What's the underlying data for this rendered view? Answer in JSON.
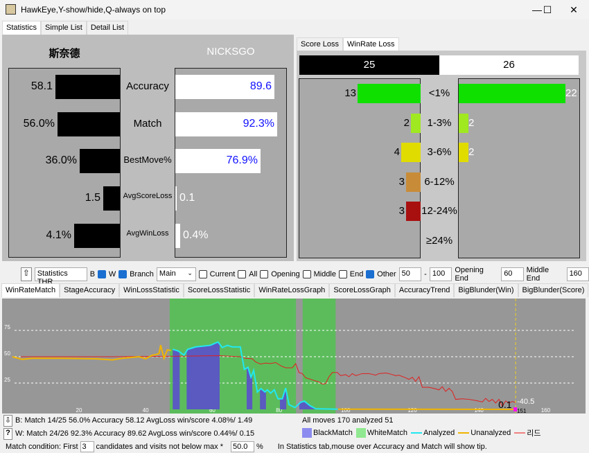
{
  "window": {
    "title": "HawkEye,Y-show/hide,Q-always on top"
  },
  "main_tabs": [
    "Statistics",
    "Simple List",
    "Detail List"
  ],
  "stats": {
    "black_name": "斯奈德",
    "white_name": "NICKSGO",
    "rows": [
      {
        "label": "Accuracy",
        "black": "58.1",
        "white": "89.6",
        "black_value": 58.1,
        "white_value": 89.6
      },
      {
        "label": "Match",
        "black": "56.0%",
        "white": "92.3%",
        "black_value": 56.0,
        "white_value": 92.3
      },
      {
        "label": "BestMove%",
        "black": "36.0%",
        "white": "76.9%",
        "black_value": 36.0,
        "white_value": 76.9
      },
      {
        "label": "AvgScoreLoss",
        "black": "1.5",
        "white": "0.1",
        "black_value": 1.5,
        "white_value": 0.1
      },
      {
        "label": "AvgWinLoss",
        "black": "4.1%",
        "white": "0.4%",
        "black_value": 4.1,
        "white_value": 0.4
      }
    ]
  },
  "loss_tabs": [
    "Score Loss",
    "WinRate Loss"
  ],
  "loss": {
    "black_total": "25",
    "white_total": "26",
    "rows": [
      {
        "label": "<1%",
        "black": "13",
        "white": "22",
        "color": "#10e000"
      },
      {
        "label": "1-3%",
        "black": "2",
        "white": "2",
        "color": "#a0e820"
      },
      {
        "label": "3-6%",
        "black": "4",
        "white": "2",
        "color": "#e0dc00"
      },
      {
        "label": "6-12%",
        "black": "3",
        "white": "",
        "color": "#c88c38"
      },
      {
        "label": "12-24%",
        "black": "3",
        "white": "",
        "color": "#a81010"
      },
      {
        "label": "≥24%",
        "black": "",
        "white": "",
        "color": "#888888"
      }
    ]
  },
  "toolbar": {
    "stats_thr": "Statistics THR",
    "b": "B",
    "w": "W",
    "w_checked": true,
    "branch": "Branch",
    "branch_checked": true,
    "branch_select": "Main",
    "current": "Current",
    "all": "All",
    "opening": "Opening",
    "middle": "Middle",
    "end": "End",
    "other": "Other",
    "other_checked": true,
    "range_from": "50",
    "dash": "-",
    "range_to": "100",
    "opening_end": "Opening End",
    "opening_end_val": "60",
    "middle_end": "Middle End",
    "middle_end_val": "160"
  },
  "chart_tabs": [
    "WinRateMatch",
    "StageAccuracy",
    "WinLossStatistic",
    "ScoreLossStatistic",
    "WinRateLossGraph",
    "ScoreLossGraph",
    "AccuracyTrend",
    "BigBlunder(Win)",
    "BigBlunder(Score)"
  ],
  "chart_data": {
    "type": "line",
    "xticks": [
      20,
      40,
      60,
      80,
      100,
      120,
      140,
      160
    ],
    "yticks": [
      25,
      50,
      75
    ],
    "xlim": [
      0,
      170
    ],
    "ylim": [
      0,
      100
    ],
    "grid": true,
    "white_match_ranges": [
      [
        47.2,
        85.1
      ],
      [
        87.1,
        97
      ]
    ],
    "black_match_ranges": [
      [
        48.1,
        50.2
      ],
      [
        52.3,
        62.2
      ],
      [
        70.3,
        72
      ],
      [
        74.3,
        76.1
      ],
      [
        80.3,
        82.2
      ],
      [
        86.1,
        94.1
      ],
      [
        96,
        98.3
      ]
    ],
    "series": [
      {
        "name": "Unanalyzed",
        "color": "#f0b400",
        "points": [
          [
            0,
            50
          ],
          [
            3,
            47.5
          ],
          [
            6,
            48.5
          ],
          [
            15,
            48.5
          ],
          [
            25,
            48
          ],
          [
            30,
            47
          ],
          [
            33,
            48.5
          ],
          [
            38,
            50
          ],
          [
            40,
            48
          ],
          [
            42,
            51.5
          ],
          [
            43,
            52
          ],
          [
            44,
            53
          ],
          [
            44.5,
            61
          ],
          [
            45.5,
            48.5
          ],
          [
            46.5,
            56.5
          ],
          [
            47.6,
            56
          ]
        ]
      },
      {
        "name": "Analyzed",
        "color": "#20e8f0",
        "points": [
          [
            48.1,
            57.1
          ],
          [
            49.8,
            55.4
          ],
          [
            51.5,
            51.5
          ],
          [
            52.6,
            57
          ],
          [
            55,
            59.3
          ],
          [
            59.4,
            60.8
          ],
          [
            61.7,
            64
          ],
          [
            63,
            58.7
          ],
          [
            64.5,
            60.8
          ],
          [
            66,
            59.3
          ],
          [
            68.4,
            59.3
          ],
          [
            69.6,
            38
          ],
          [
            70.7,
            40
          ],
          [
            71.6,
            30.5
          ],
          [
            72.4,
            37
          ],
          [
            73.5,
            16.5
          ],
          [
            74.6,
            19.7
          ],
          [
            75.8,
            16.5
          ],
          [
            76.5,
            18.6
          ],
          [
            77.5,
            15.4
          ],
          [
            78.6,
            18.6
          ],
          [
            79.7,
            10
          ],
          [
            81,
            10
          ],
          [
            82,
            20.3
          ],
          [
            83,
            4.5
          ],
          [
            84.8,
            1.7
          ],
          [
            86.5,
            6.7
          ],
          [
            87.6,
            7.8
          ],
          [
            89.3,
            3.5
          ],
          [
            91,
            0.6
          ],
          [
            97.7,
            0.2
          ]
        ]
      },
      {
        "name": "Unanalyzed",
        "color": "#f0b400",
        "points": [
          [
            97.7,
            0.2
          ],
          [
            151,
            0
          ]
        ]
      },
      {
        "name": "리드",
        "color": "#e02020",
        "points": [
          [
            2.5,
            50
          ],
          [
            30,
            50
          ],
          [
            50,
            50.5
          ],
          [
            62,
            51
          ],
          [
            68.4,
            50
          ],
          [
            70,
            48.5
          ],
          [
            72,
            48
          ],
          [
            73,
            45
          ],
          [
            74.5,
            43
          ],
          [
            76,
            44
          ],
          [
            77.5,
            43.5
          ],
          [
            79,
            44.5
          ],
          [
            80.5,
            41.5
          ],
          [
            82,
            39.5
          ],
          [
            84,
            39.5
          ],
          [
            85,
            43.5
          ],
          [
            86,
            35
          ],
          [
            87,
            34
          ],
          [
            88,
            30
          ],
          [
            90,
            28
          ],
          [
            92,
            26
          ],
          [
            93,
            24
          ],
          [
            94,
            24.5
          ],
          [
            95,
            31
          ],
          [
            96,
            35
          ],
          [
            97.5,
            35
          ],
          [
            98.5,
            32
          ],
          [
            100,
            33
          ],
          [
            101,
            31
          ],
          [
            102,
            34
          ],
          [
            103,
            32
          ],
          [
            105,
            34
          ],
          [
            107,
            34
          ],
          [
            109,
            32.5
          ],
          [
            110,
            34
          ],
          [
            112,
            34.5
          ],
          [
            113,
            34
          ],
          [
            115,
            32
          ],
          [
            116,
            32.5
          ],
          [
            118,
            30
          ],
          [
            119,
            28.5
          ],
          [
            120,
            30.5
          ],
          [
            121,
            26.5
          ],
          [
            122,
            31
          ],
          [
            123,
            21
          ],
          [
            125,
            21
          ],
          [
            127,
            19.5
          ],
          [
            128,
            18.5
          ],
          [
            129,
            21.5
          ],
          [
            130,
            17
          ],
          [
            131,
            20
          ],
          [
            132,
            17
          ],
          [
            133,
            9.5
          ],
          [
            135,
            10
          ],
          [
            137,
            9.5
          ],
          [
            139,
            8.5
          ],
          [
            141,
            7
          ],
          [
            142,
            10.5
          ],
          [
            143,
            7.5
          ],
          [
            144,
            9.5
          ],
          [
            145,
            6
          ],
          [
            146,
            9.5
          ],
          [
            147,
            3
          ],
          [
            148,
            8
          ],
          [
            149,
            6
          ],
          [
            150,
            7.5
          ],
          [
            151,
            6.5
          ]
        ]
      }
    ],
    "current_move": 151,
    "current_label": "151",
    "value_label": "0.1",
    "lead_label": "-40.5"
  },
  "footer": {
    "b_line": "B: Match 14/25 56.0% Accuracy 58.12 AvgLoss win/score 4.08%/ 1.49",
    "w_line": "W: Match 24/26 92.3% Accuracy 89.62 AvgLoss win/score 0.44%/ 0.15",
    "all_moves": "All moves 170 analyzed 51",
    "legend": [
      {
        "label": "BlackMatch",
        "color": "#8c8cf0"
      },
      {
        "label": "WhiteMatch",
        "color": "#90e890"
      },
      {
        "label": "Analyzed",
        "color": "#20e8f0"
      },
      {
        "label": "Unanalyzed",
        "color": "#f0b400"
      },
      {
        "label": "리드",
        "color": "#f08080"
      }
    ],
    "cond_prefix": "Match condition: First",
    "cond_first": "3",
    "cond_mid": "candidates and visits not below max *",
    "cond_pct": "50.0",
    "cond_suffix": "%",
    "tip": "In Statistics tab,mouse over Accuracy and Match will show tip."
  }
}
